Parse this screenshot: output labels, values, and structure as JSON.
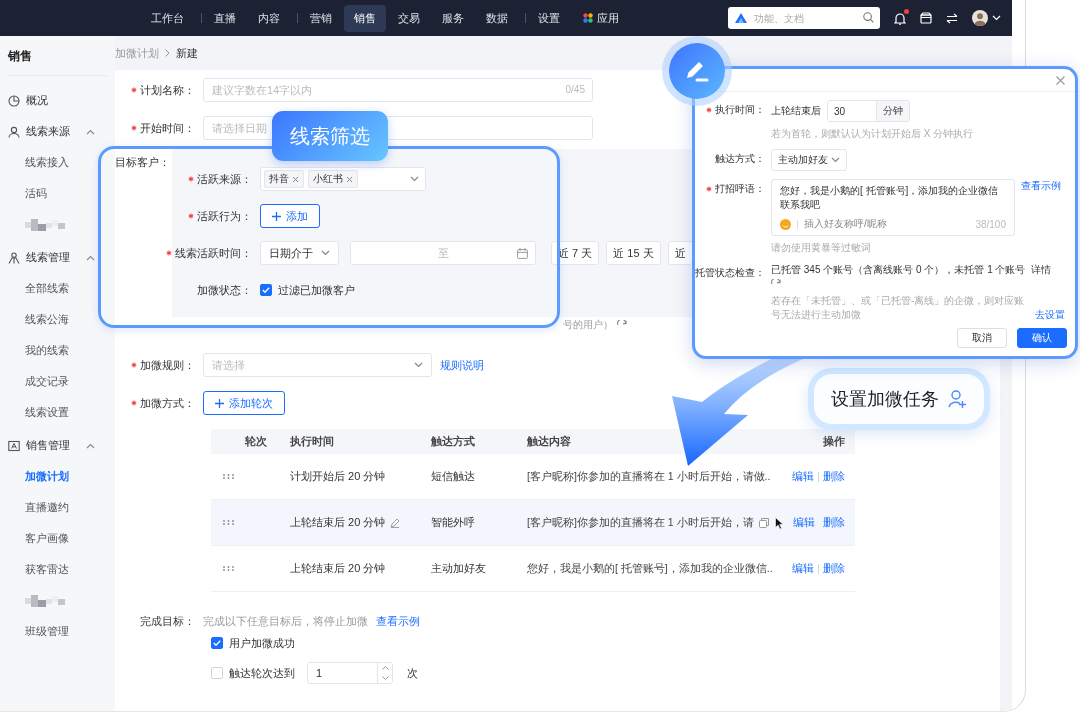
{
  "top_bar": {
    "items": [
      {
        "label": "工作台",
        "selected": false,
        "divider_after": true
      },
      {
        "label": "直播",
        "selected": false,
        "divider_after": false
      },
      {
        "label": "内容",
        "selected": false,
        "divider_after": true
      },
      {
        "label": "营销",
        "selected": false,
        "divider_after": false
      },
      {
        "label": "销售",
        "selected": true,
        "divider_after": false
      },
      {
        "label": "交易",
        "selected": false,
        "divider_after": false
      },
      {
        "label": "服务",
        "selected": false,
        "divider_after": false
      },
      {
        "label": "数据",
        "selected": false,
        "divider_after": true
      },
      {
        "label": "设置",
        "selected": false,
        "divider_after": false
      }
    ],
    "apps_label": "应用",
    "search": {
      "placeholder": "功能、文档"
    },
    "unread": true
  },
  "sidebar": {
    "title": "销售",
    "items": [
      {
        "kind": "link",
        "label": "概况",
        "selected": false
      },
      {
        "kind": "group",
        "label": "线索来源",
        "expanded": true,
        "children": [
          {
            "kind": "link",
            "label": "线索接入",
            "selected": false
          },
          {
            "kind": "link",
            "label": "活码",
            "selected": false
          },
          {
            "kind": "pixelated"
          }
        ]
      },
      {
        "kind": "group",
        "label": "线索管理",
        "expanded": true,
        "children": [
          {
            "kind": "link",
            "label": "全部线索",
            "selected": false
          },
          {
            "kind": "link",
            "label": "线索公海",
            "selected": false
          },
          {
            "kind": "link",
            "label": "我的线索",
            "selected": false
          },
          {
            "kind": "link",
            "label": "成交记录",
            "selected": false
          },
          {
            "kind": "link",
            "label": "线索设置",
            "selected": false
          }
        ]
      },
      {
        "kind": "group",
        "label": "销售管理",
        "expanded": true,
        "children": [
          {
            "kind": "link",
            "label": "加微计划",
            "selected": true
          },
          {
            "kind": "link",
            "label": "直播邀约",
            "selected": false
          },
          {
            "kind": "link",
            "label": "客户画像",
            "selected": false
          },
          {
            "kind": "link",
            "label": "获客雷达",
            "selected": false
          },
          {
            "kind": "pixelated"
          },
          {
            "kind": "link",
            "label": "班级管理",
            "selected": false
          }
        ]
      }
    ]
  },
  "breadcrumb": [
    "加微计划",
    "新建"
  ],
  "form": {
    "plan_name": {
      "label": "计划名称：",
      "required": true,
      "placeholder": "建议字数在14字以内",
      "count": "0/45"
    },
    "start_time": {
      "label": "开始时间：",
      "required": true,
      "placeholder": "请选择日期"
    },
    "target": {
      "label": "目标客户：",
      "source": {
        "label": "活跃来源：",
        "required": true,
        "tags": [
          "抖音",
          "小红书"
        ]
      },
      "behavior": {
        "label": "活跃行为：",
        "required": true,
        "button": "添加"
      },
      "active_time": {
        "label": "线索活跃时间：",
        "required": true,
        "mode": "日期介于",
        "range_separator": "至",
        "quick_ranges": [
          "近 7 天",
          "近 15 天",
          "近"
        ]
      },
      "status": {
        "label": "加微状态：",
        "required": false,
        "option": "过滤已加微客户",
        "checked": true
      },
      "note": "号的用户）"
    },
    "rule": {
      "label": "加微规则：",
      "required": true,
      "placeholder": "请选择",
      "link": "规则说明"
    },
    "method": {
      "label": "加微方式：",
      "required": true,
      "button": "添加轮次"
    },
    "table": {
      "columns": [
        "轮次",
        "执行时间",
        "触达方式",
        "触达内容",
        "操作"
      ],
      "rows": [
        {
          "time": "计划开始后 20 分钟",
          "channel": "短信触达",
          "content": "[客户昵称]你参加的直播将在 1 小时后开始，请做..",
          "actions": [
            "编辑",
            "删除"
          ],
          "selected": false
        },
        {
          "time": "上轮结束后 20 分钟",
          "channel": "智能外呼",
          "content": "[客户昵称]你参加的直播将在 1 小时后开始，请",
          "actions": [
            "编辑",
            "删除"
          ],
          "selected": true
        },
        {
          "time": "上轮结束后 20 分钟",
          "channel": "主动加好友",
          "content": "您好，我是小鹅的[ 托管账号]，添加我的企业微信..",
          "actions": [
            "编辑",
            "删除"
          ],
          "selected": false
        }
      ]
    },
    "goal": {
      "label": "完成目标：",
      "required": false,
      "hint": "完成以下任意目标后，将停止加微",
      "link": "查看示例",
      "options": [
        {
          "kind": "check",
          "label": "用户加微成功",
          "checked": true
        },
        {
          "kind": "count",
          "label": "触达轮次达到",
          "checked": false,
          "value": "1",
          "unit": "次"
        }
      ]
    }
  },
  "edit_dialog": {
    "fields": [
      {
        "kind": "duration",
        "label": "执行时间：",
        "required": true,
        "prefix": "上轮结束后",
        "value": "30",
        "unit": "分钟",
        "hint": "若为首轮，则默认认为计划开始后 X 分钟执行"
      },
      {
        "kind": "select",
        "label": "触达方式：",
        "required": false,
        "value": "主动加好友"
      },
      {
        "kind": "textarea",
        "label": "打招呼语：",
        "required": true,
        "value": "您好，我是小鹅的[ 托管账号]，添加我的企业微信联系我吧",
        "insert_label": "插入好友称呼/昵称",
        "count": "38/100",
        "link": "查看示例",
        "hint": "请勿使用黄暴等过敏词"
      },
      {
        "kind": "status",
        "label": "托管状态检查：",
        "required": false,
        "text": "已托管 345 个账号（含离线账号 0 个），未托管 1 个账号",
        "detail": "详情",
        "hint": "若存在「未托管」、或「已托管-离线」的企微，则对应账号无法进行主动加微",
        "link": "去设置"
      }
    ],
    "buttons": [
      {
        "label": "取消",
        "primary": false
      },
      {
        "label": "确认",
        "primary": true
      }
    ]
  },
  "callouts": [
    {
      "kind": "badge",
      "text": "线索筛选"
    },
    {
      "kind": "pill",
      "text": "设置加微任务"
    }
  ]
}
